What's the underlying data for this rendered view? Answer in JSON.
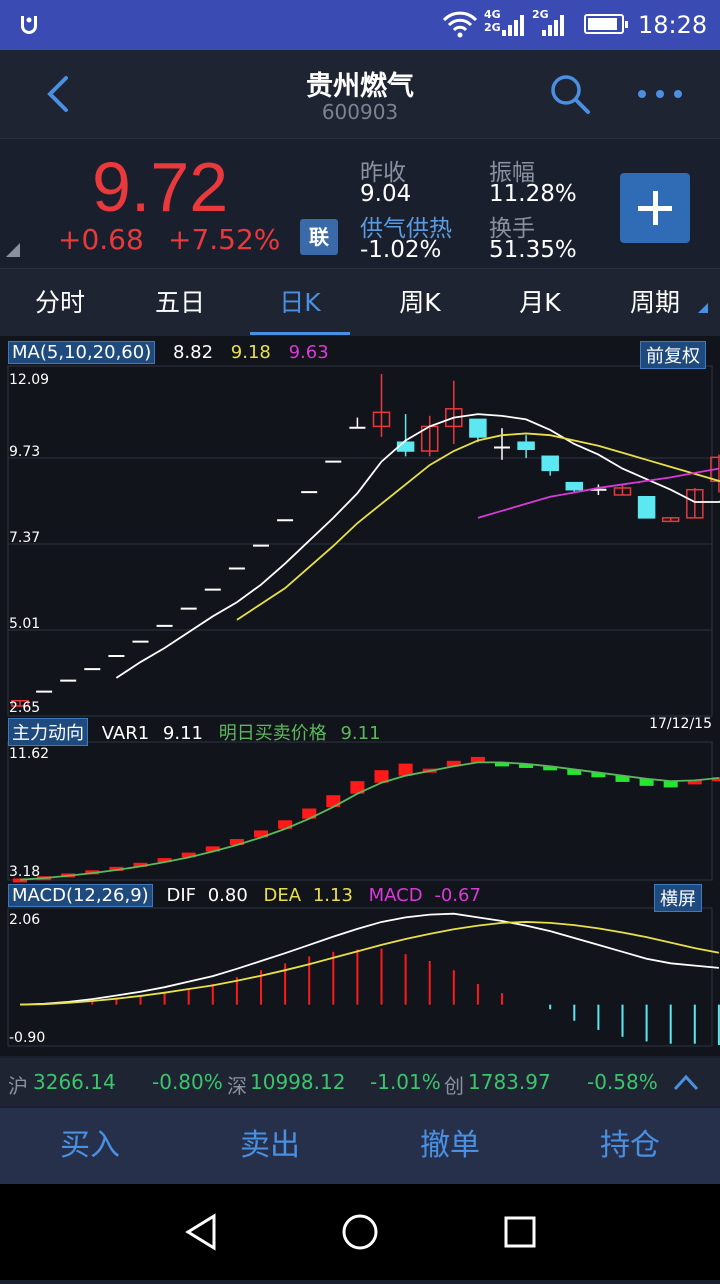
{
  "status_bar": {
    "time": "18:28",
    "net1": "4G",
    "net1b": "2G",
    "net2": "2G",
    "battery_level": 0.9
  },
  "header": {
    "title": "贵州燃气",
    "code": "600903"
  },
  "quote": {
    "price": "9.72",
    "change": "+0.68",
    "change_pct": "+7.52%",
    "lian_label": "联",
    "prev_close_label": "昨收",
    "prev_close": "9.04",
    "sector_label": "供气供热",
    "sector_change": "-1.02%",
    "amplitude_label": "振幅",
    "amplitude": "11.28%",
    "turnover_label": "换手",
    "turnover": "51.35%"
  },
  "tabs": [
    "分时",
    "五日",
    "日K",
    "周K",
    "月K",
    "周期"
  ],
  "main_chart": {
    "ma_label": "MA(5,10,20,60)",
    "ma5": "8.82",
    "ma10": "9.18",
    "ma20": "9.63",
    "fq_label": "前复权",
    "y_ticks": [
      "12.09",
      "9.73",
      "7.37",
      "5.01",
      "2.65"
    ]
  },
  "sub_chart1": {
    "label": "主力动向",
    "var1_label": "VAR1",
    "var1": "9.11",
    "price_label": "明日买卖价格",
    "price": "9.11",
    "date": "17/12/15",
    "y_top": "11.62",
    "y_bottom": "3.18"
  },
  "sub_chart2": {
    "label": "MACD(12,26,9)",
    "dif_label": "DIF",
    "dif": "0.80",
    "dea_label": "DEA",
    "dea": "1.13",
    "macd_label": "MACD",
    "macd": "-0.67",
    "landscape_label": "横屏",
    "y_top": "2.06",
    "y_bottom": "-0.90"
  },
  "index_bar": {
    "sh_label": "沪",
    "sh": "3266.14",
    "sh_chg": "-0.80%",
    "sz_label": "深",
    "sz": "10998.12",
    "sz_chg": "-1.01%",
    "cy_label": "创",
    "cy": "1783.97",
    "cy_chg": "-0.58%"
  },
  "trade_bar": {
    "buy": "买入",
    "sell": "卖出",
    "cancel": "撤单",
    "position": "持仓"
  },
  "colors": {
    "up": "#e8393c",
    "down": "#5ce8f0",
    "ma5": "#ffffff",
    "ma10": "#e8e04a",
    "ma20": "#d83ad8",
    "accent": "#4a90e2"
  },
  "chart_data": [
    {
      "type": "candlestick",
      "title": "日K",
      "ylim": [
        2.65,
        12.09
      ],
      "candles": [
        {
          "o": 2.65,
          "h": 2.8,
          "l": 2.65,
          "c": 2.8
        },
        {
          "o": 3.06,
          "h": 3.06,
          "l": 3.06,
          "c": 3.06
        },
        {
          "o": 3.37,
          "h": 3.37,
          "l": 3.37,
          "c": 3.37
        },
        {
          "o": 3.7,
          "h": 3.7,
          "l": 3.7,
          "c": 3.7
        },
        {
          "o": 4.07,
          "h": 4.07,
          "l": 4.07,
          "c": 4.07
        },
        {
          "o": 4.48,
          "h": 4.48,
          "l": 4.48,
          "c": 4.48
        },
        {
          "o": 4.93,
          "h": 4.93,
          "l": 4.93,
          "c": 4.93
        },
        {
          "o": 5.42,
          "h": 5.42,
          "l": 5.42,
          "c": 5.42
        },
        {
          "o": 5.96,
          "h": 5.96,
          "l": 5.96,
          "c": 5.96
        },
        {
          "o": 6.56,
          "h": 6.56,
          "l": 6.56,
          "c": 6.56
        },
        {
          "o": 7.21,
          "h": 7.21,
          "l": 7.21,
          "c": 7.21
        },
        {
          "o": 7.93,
          "h": 7.93,
          "l": 7.93,
          "c": 7.93
        },
        {
          "o": 8.73,
          "h": 8.73,
          "l": 8.73,
          "c": 8.73
        },
        {
          "o": 9.6,
          "h": 9.6,
          "l": 9.6,
          "c": 9.6
        },
        {
          "o": 10.56,
          "h": 10.85,
          "l": 10.56,
          "c": 10.56
        },
        {
          "o": 10.6,
          "h": 12.09,
          "l": 10.3,
          "c": 11.0
        },
        {
          "o": 10.15,
          "h": 10.95,
          "l": 9.75,
          "c": 9.9
        },
        {
          "o": 9.9,
          "h": 10.9,
          "l": 9.75,
          "c": 10.6
        },
        {
          "o": 10.6,
          "h": 11.9,
          "l": 10.1,
          "c": 11.1
        },
        {
          "o": 10.8,
          "h": 10.8,
          "l": 10.15,
          "c": 10.3
        },
        {
          "o": 10.0,
          "h": 10.55,
          "l": 9.65,
          "c": 10.0
        },
        {
          "o": 10.15,
          "h": 10.35,
          "l": 9.7,
          "c": 9.95
        },
        {
          "o": 9.75,
          "h": 9.75,
          "l": 9.2,
          "c": 9.35
        },
        {
          "o": 9.0,
          "h": 9.0,
          "l": 8.7,
          "c": 8.8
        },
        {
          "o": 8.8,
          "h": 8.95,
          "l": 8.65,
          "c": 8.8
        },
        {
          "o": 8.65,
          "h": 8.95,
          "l": 8.65,
          "c": 8.85
        },
        {
          "o": 8.6,
          "h": 8.6,
          "l": 7.98,
          "c": 8.0
        },
        {
          "o": 7.9,
          "h": 8.02,
          "l": 7.9,
          "c": 8.0
        },
        {
          "o": 8.0,
          "h": 8.85,
          "l": 8.0,
          "c": 8.8
        },
        {
          "o": 9.04,
          "h": 9.8,
          "l": 8.72,
          "c": 9.72
        }
      ],
      "series": [
        {
          "name": "MA5",
          "start": 4,
          "values": [
            3.45,
            3.9,
            4.3,
            4.75,
            5.2,
            5.6,
            6.1,
            6.7,
            7.35,
            8.0,
            8.7,
            9.6,
            10.2,
            10.6,
            10.85,
            10.95,
            10.9,
            10.8,
            10.5,
            10.1,
            9.8,
            9.4,
            9.1,
            8.8,
            8.45,
            8.45,
            8.7
          ]
        },
        {
          "name": "MA10",
          "start": 9,
          "values": [
            5.1,
            5.55,
            6.0,
            6.6,
            7.2,
            7.85,
            8.4,
            8.95,
            9.5,
            9.9,
            10.2,
            10.35,
            10.4,
            10.35,
            10.2,
            10.05,
            9.85,
            9.65,
            9.45,
            9.25,
            9.05,
            8.9
          ]
        },
        {
          "name": "MA20",
          "start": 19,
          "values": [
            8.0,
            8.2,
            8.4,
            8.6,
            8.72,
            8.85,
            8.95,
            9.05,
            9.15,
            9.28,
            9.4
          ]
        }
      ]
    },
    {
      "type": "bar",
      "title": "主力动向",
      "ylim": [
        3.18,
        11.62
      ],
      "values": [
        3.28,
        3.42,
        3.6,
        3.8,
        4.02,
        4.28,
        4.58,
        4.93,
        5.33,
        5.8,
        6.35,
        7.0,
        7.75,
        8.6,
        9.5,
        10.2,
        10.62,
        10.3,
        10.8,
        11.05,
        10.7,
        10.45,
        10.2,
        9.9,
        9.75,
        9.45,
        9.2,
        9.1,
        9.5,
        9.75
      ],
      "direction": [
        1,
        1,
        1,
        1,
        1,
        1,
        1,
        1,
        1,
        1,
        1,
        1,
        1,
        1,
        1,
        1,
        1,
        1,
        1,
        1,
        -1,
        -1,
        -1,
        -1,
        -1,
        -1,
        -1,
        -1,
        1,
        1
      ],
      "series": [
        {
          "name": "VAR1",
          "values": [
            3.2,
            3.3,
            3.45,
            3.62,
            3.82,
            4.05,
            4.32,
            4.63,
            5.0,
            5.42,
            5.9,
            6.45,
            7.1,
            7.85,
            8.7,
            9.4,
            9.85,
            10.15,
            10.45,
            10.7,
            10.7,
            10.6,
            10.45,
            10.25,
            10.05,
            9.85,
            9.65,
            9.5,
            9.55,
            9.7
          ]
        }
      ]
    },
    {
      "type": "bar",
      "title": "MACD(12,26,9)",
      "ylim": [
        -0.9,
        2.06
      ],
      "hist": [
        0,
        0,
        0,
        0.08,
        0.14,
        0.2,
        0.27,
        0.35,
        0.45,
        0.6,
        0.75,
        0.9,
        1.05,
        1.15,
        1.2,
        1.22,
        1.1,
        0.95,
        0.75,
        0.45,
        0.25,
        0,
        -0.1,
        -0.35,
        -0.55,
        -0.7,
        -0.8,
        -0.85,
        -0.85,
        -0.88
      ],
      "series": [
        {
          "name": "DIF",
          "values": [
            0,
            0.02,
            0.06,
            0.12,
            0.2,
            0.28,
            0.38,
            0.5,
            0.62,
            0.78,
            0.95,
            1.12,
            1.3,
            1.48,
            1.65,
            1.8,
            1.9,
            1.96,
            1.98,
            1.9,
            1.82,
            1.72,
            1.6,
            1.45,
            1.3,
            1.15,
            1.0,
            0.9,
            0.85,
            0.8
          ]
        },
        {
          "name": "DEA",
          "values": [
            0,
            0.01,
            0.04,
            0.08,
            0.13,
            0.19,
            0.26,
            0.34,
            0.42,
            0.52,
            0.63,
            0.75,
            0.88,
            1.02,
            1.16,
            1.3,
            1.43,
            1.54,
            1.64,
            1.72,
            1.78,
            1.8,
            1.78,
            1.73,
            1.66,
            1.57,
            1.47,
            1.35,
            1.23,
            1.13
          ]
        }
      ]
    }
  ]
}
